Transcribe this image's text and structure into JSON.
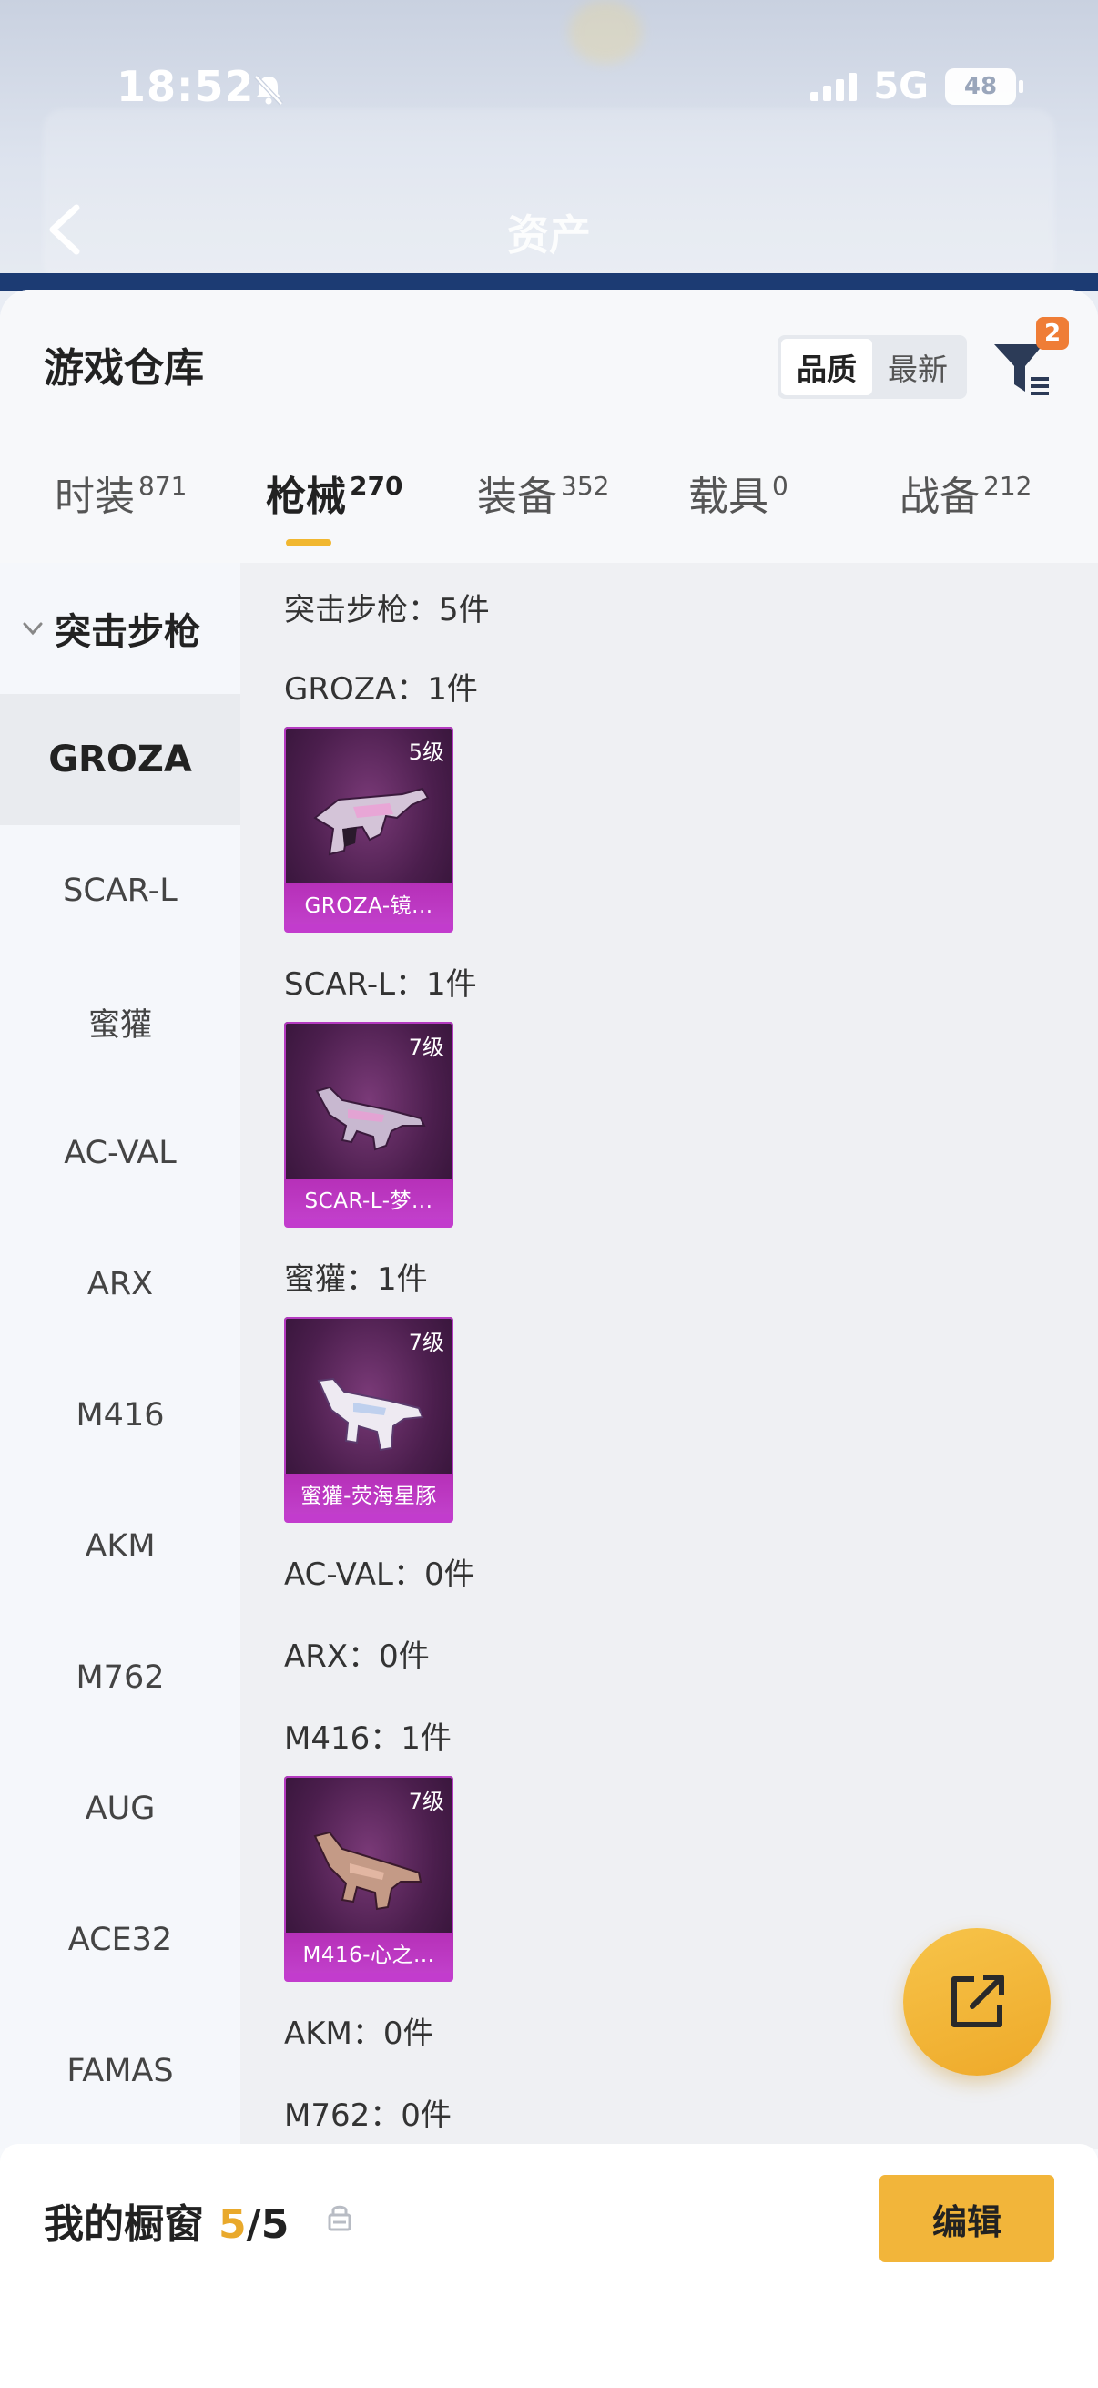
{
  "status_bar": {
    "time": "18:52",
    "network": "5G",
    "battery": "48"
  },
  "header": {
    "title": "资产"
  },
  "sheet": {
    "title": "游戏仓库",
    "sort": {
      "options": [
        "品质",
        "最新"
      ],
      "selected": "品质"
    },
    "filter_badge": "2"
  },
  "tabs": [
    {
      "label": "时装",
      "count": "871"
    },
    {
      "label": "枪械",
      "count": "270",
      "active": true
    },
    {
      "label": "装备",
      "count": "352"
    },
    {
      "label": "载具",
      "count": "0"
    },
    {
      "label": "战备",
      "count": "212"
    }
  ],
  "sidebar": {
    "group": "突击步枪",
    "items": [
      "GROZA",
      "SCAR-L",
      "蜜獾",
      "AC-VAL",
      "ARX",
      "M416",
      "AKM",
      "M762",
      "AUG",
      "ACE32",
      "FAMAS"
    ],
    "active": "GROZA"
  },
  "content": {
    "group_title": "突击步枪：5件",
    "weapons": [
      {
        "title": "GROZA：1件",
        "card": {
          "level": "5级",
          "name": "GROZA-镜..."
        }
      },
      {
        "title": "SCAR-L：1件",
        "card": {
          "level": "7级",
          "name": "SCAR-L-梦..."
        }
      },
      {
        "title": "蜜獾：1件",
        "card": {
          "level": "7级",
          "name": "蜜獾-荧海星豚"
        }
      },
      {
        "title": "AC-VAL：0件"
      },
      {
        "title": "ARX：0件"
      },
      {
        "title": "M416：1件",
        "card": {
          "level": "7级",
          "name": "M416-心之..."
        }
      },
      {
        "title": "AKM：0件"
      },
      {
        "title": "M762：0件"
      }
    ]
  },
  "showcase": {
    "label": "我的橱窗",
    "count": "5",
    "sep": "/",
    "total": "5",
    "edit_label": "编辑"
  },
  "colors": {
    "accent": "#f2b53a",
    "badge": "#ef7d36",
    "rarity_purple": "#c23ccd"
  }
}
